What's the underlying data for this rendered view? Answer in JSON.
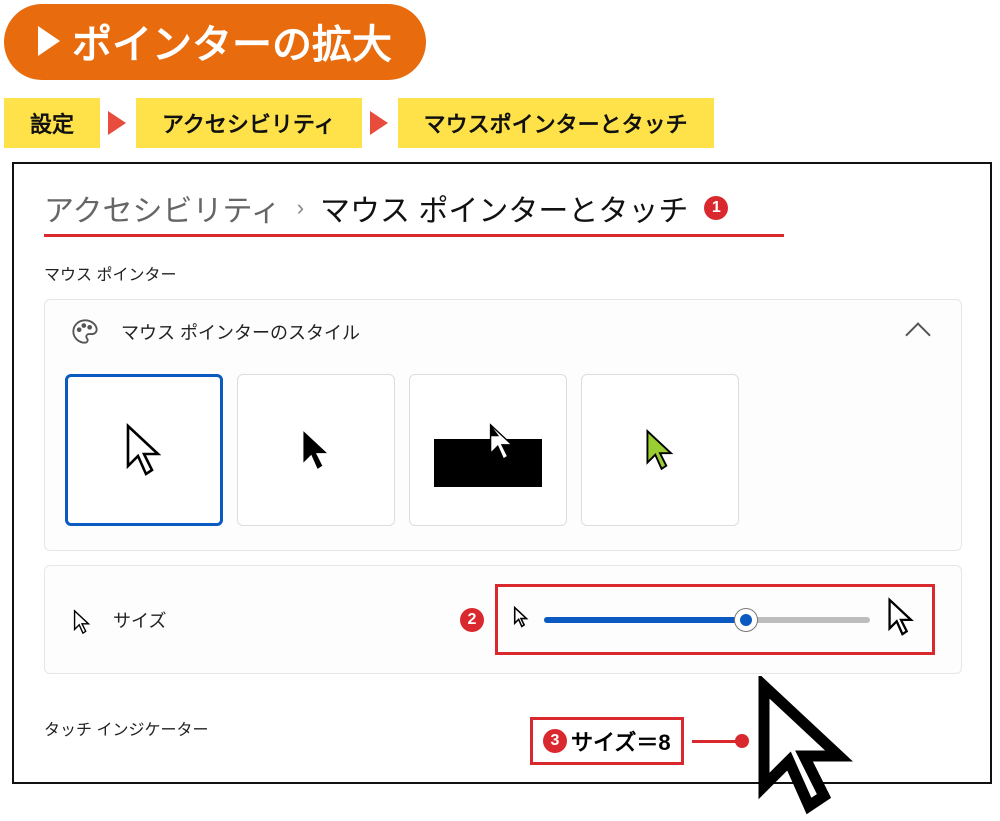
{
  "banner": {
    "title": "ポインターの拡大"
  },
  "path": {
    "step1": "設定",
    "step2": "アクセシビリティ",
    "step3": "マウスポインターとタッチ"
  },
  "breadcrumb": {
    "parent": "アクセシビリティ",
    "separator": "›",
    "current": "マウス ポインターとタッチ"
  },
  "callouts": {
    "one": "1",
    "two": "2",
    "three": "3"
  },
  "section": {
    "mouse_pointer": "マウス ポインター",
    "touch_indicator": "タッチ インジケーター"
  },
  "style_card": {
    "title": "マウス ポインターのスタイル"
  },
  "size_card": {
    "label": "サイズ",
    "slider_percent": 62
  },
  "annotation": {
    "size_text": "サイズ＝8"
  }
}
